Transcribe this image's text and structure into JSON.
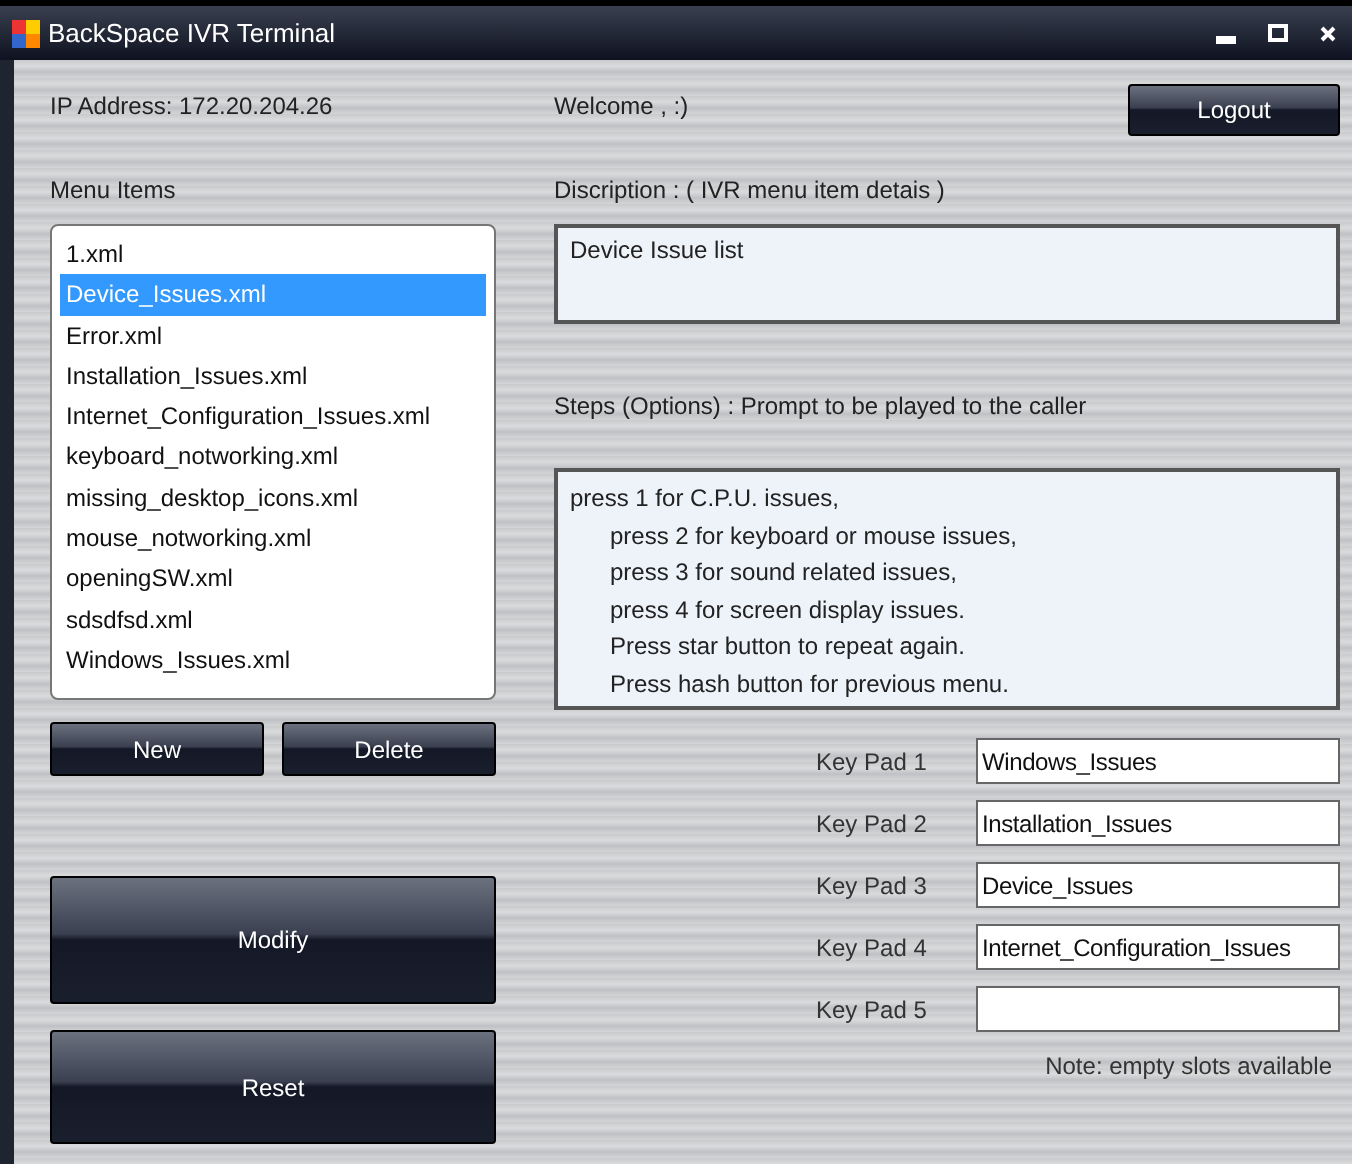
{
  "window": {
    "title": "BackSpace IVR Terminal"
  },
  "ip_address": "IP Address:  172.20.204.26",
  "welcome": "Welcome ,   :)",
  "logout_button": "Logout",
  "menu_items": {
    "label": "Menu Items",
    "items": [
      {
        "text": "1.xml",
        "selected": false
      },
      {
        "text": "Device_Issues.xml",
        "selected": true
      },
      {
        "text": "Error.xml",
        "selected": false
      },
      {
        "text": "Installation_Issues.xml",
        "selected": false
      },
      {
        "text": "Internet_Configuration_Issues.xml",
        "selected": false
      },
      {
        "text": "keyboard_notworking.xml",
        "selected": false
      },
      {
        "text": "missing_desktop_icons.xml",
        "selected": false
      },
      {
        "text": "mouse_notworking.xml",
        "selected": false
      },
      {
        "text": "openingSW.xml",
        "selected": false
      },
      {
        "text": "sdsdfsd.xml",
        "selected": false
      },
      {
        "text": "Windows_Issues.xml",
        "selected": false
      }
    ]
  },
  "new_button": "New",
  "delete_button": "Delete",
  "modify_button": "Modify",
  "reset_button": "Reset",
  "description": {
    "label": "Discription : ( IVR  menu item detais )",
    "value": "Device Issue list"
  },
  "steps": {
    "label": "Steps (Options) : Prompt to be played to the caller",
    "lines": [
      {
        "text": "press 1 for C.P.U. issues,",
        "indented": false
      },
      {
        "text": "press 2 for keyboard or mouse issues,",
        "indented": true
      },
      {
        "text": "press 3 for sound related issues,",
        "indented": true
      },
      {
        "text": "press 4 for screen display issues.",
        "indented": true
      },
      {
        "text": "Press star button to repeat again.",
        "indented": true
      },
      {
        "text": "Press hash button for previous menu.",
        "indented": true
      }
    ]
  },
  "key_pads": [
    {
      "label": "Key Pad 1",
      "value": "Windows_Issues"
    },
    {
      "label": "Key Pad 2",
      "value": "Installation_Issues"
    },
    {
      "label": "Key Pad 3",
      "value": "Device_Issues"
    },
    {
      "label": "Key Pad 4",
      "value": "Internet_Configuration_Issues"
    },
    {
      "label": "Key Pad 5"
    }
  ],
  "note": "Note: empty slots available"
}
